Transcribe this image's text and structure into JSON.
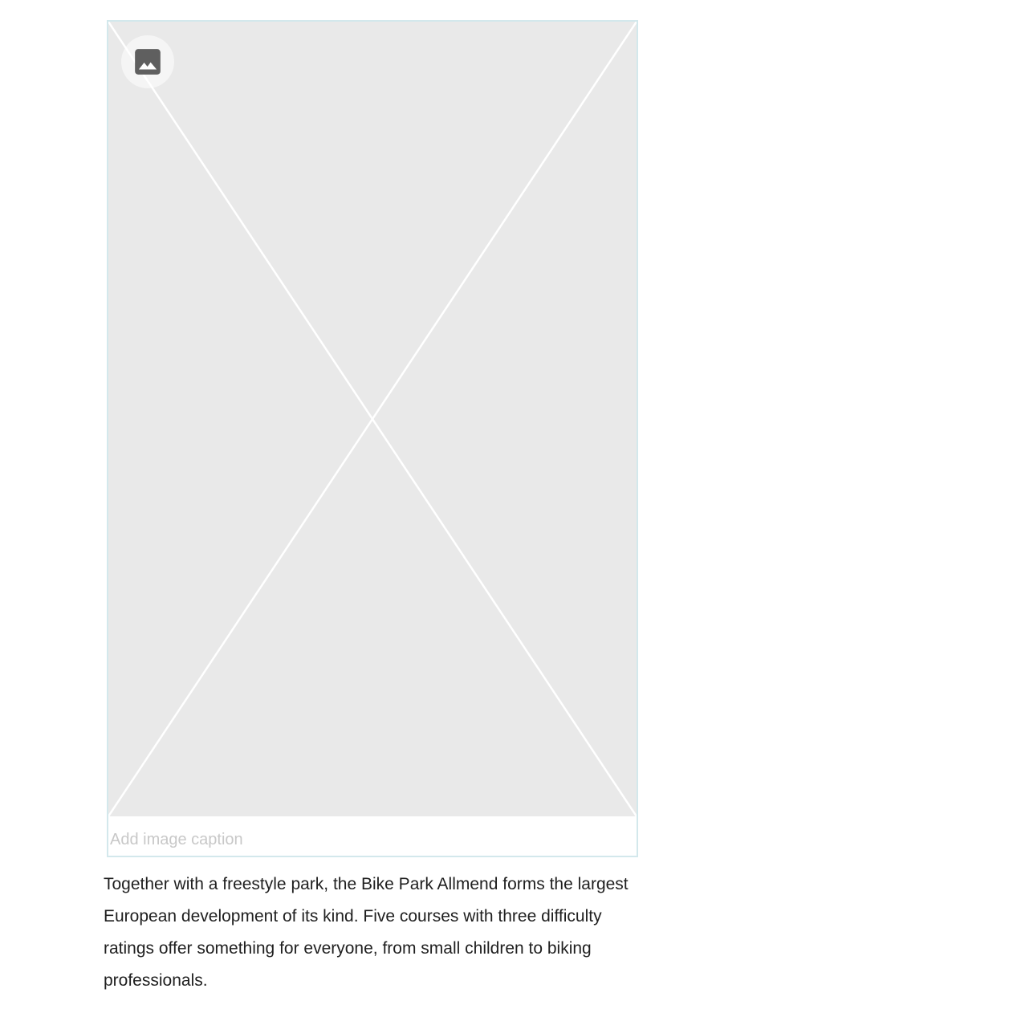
{
  "image_block": {
    "icon": "image-icon",
    "caption_placeholder": "Add image caption",
    "caption_value": ""
  },
  "paragraph": {
    "text": "Together with a freestyle park, the Bike Park Allmend forms the largest European development of its kind. Five courses with three difficulty ratings offer something for everyone, from small children to biking professionals."
  },
  "colors": {
    "placeholder_bg": "#e9e9e9",
    "selection_border": "#d3e8ec",
    "icon": "#5f5f5f",
    "caption_placeholder": "#c8c8c8",
    "body_text": "#1f1f1f"
  }
}
